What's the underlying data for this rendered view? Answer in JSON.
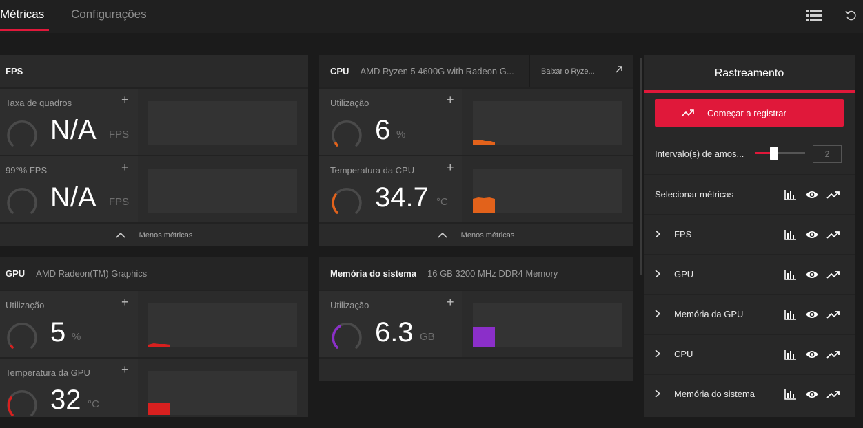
{
  "tabs": {
    "active": "Métricas",
    "inactive": "Configurações"
  },
  "top_icons": [
    "list-icon",
    "reset-icon"
  ],
  "colors": {
    "accent": "#e0183a",
    "cpu_orange": "#e2621b",
    "gpu_red": "#d8201f",
    "memory_purple": "#8b2fc9"
  },
  "fps_card": {
    "title": "FPS",
    "metrics": [
      {
        "label": "Taxa de quadros",
        "value": "N/A",
        "unit": "FPS",
        "level": 0
      },
      {
        "label": "99°% FPS",
        "value": "N/A",
        "unit": "FPS",
        "level": 0
      }
    ],
    "less_label": "Menos métricas"
  },
  "cpu_card": {
    "title": "CPU",
    "subtitle": "AMD Ryzen 5 4600G with Radeon G...",
    "download_label": "Baixar o Ryze...",
    "metrics": [
      {
        "label": "Utilização",
        "value": "6",
        "unit": "%",
        "level": 0.06
      },
      {
        "label": "Temperatura da CPU",
        "value": "34.7",
        "unit": "°C",
        "level": 0.35
      }
    ],
    "less_label": "Menos métricas"
  },
  "gpu_card": {
    "title": "GPU",
    "subtitle": "AMD Radeon(TM) Graphics",
    "metrics": [
      {
        "label": "Utilização",
        "value": "5",
        "unit": "%",
        "level": 0.05
      },
      {
        "label": "Temperatura da GPU",
        "value": "32",
        "unit": "°C",
        "level": 0.32
      }
    ]
  },
  "memory_card": {
    "title": "Memória do sistema",
    "subtitle": "16 GB 3200 MHz DDR4 Memory",
    "metrics": [
      {
        "label": "Utilização",
        "value": "6.3",
        "unit": "GB",
        "level": 0.4
      }
    ]
  },
  "tracking": {
    "title": "Rastreamento",
    "record_label": "Começar a registrar",
    "interval_label": "Intervalo(s) de amos...",
    "interval_value": "2",
    "interval_slider_level": 0.25,
    "select_label": "Selecionar métricas",
    "categories": [
      "FPS",
      "GPU",
      "Memória da GPU",
      "CPU",
      "Memória do sistema"
    ]
  }
}
